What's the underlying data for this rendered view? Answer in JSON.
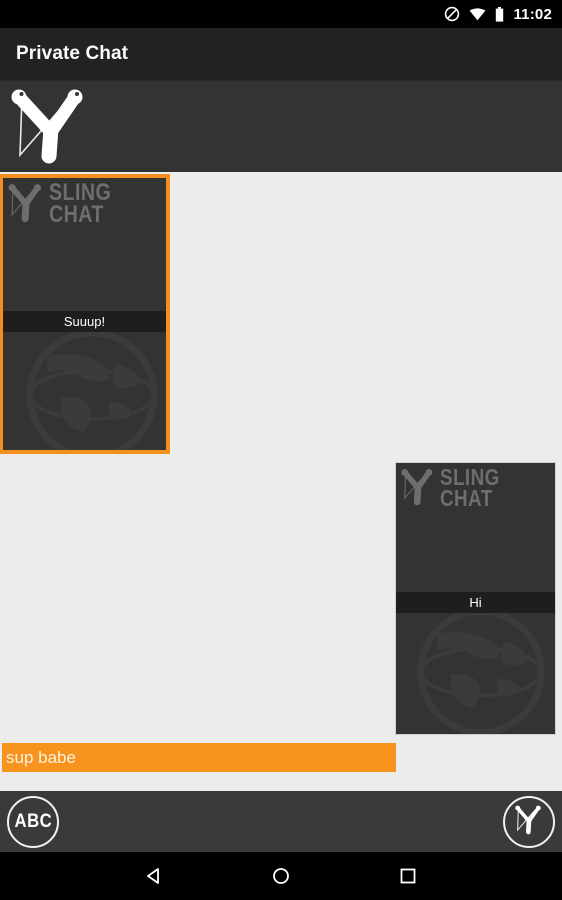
{
  "status_bar": {
    "time": "11:02",
    "icons": [
      "do-not-disturb-icon",
      "wifi-icon",
      "battery-icon"
    ]
  },
  "action_bar": {
    "title": "Private Chat"
  },
  "logo_bar": {
    "logo": "slingshot-logo-icon"
  },
  "messages": [
    {
      "id": "incoming-message",
      "side": "incoming",
      "brand_line1": "SLING",
      "brand_line2": "CHAT",
      "caption": "Suuup!",
      "selected": true,
      "border_color": "#f3901d"
    },
    {
      "id": "outgoing-message",
      "side": "outgoing",
      "brand_line1": "SLING",
      "brand_line2": "CHAT",
      "caption": "Hi",
      "selected": false,
      "border_color": "#cfcfcf"
    }
  ],
  "composer": {
    "value": "sup babe",
    "placeholder": "Type a message",
    "background": "#f7941e"
  },
  "bottom_bar": {
    "abc_label": "ABC",
    "send_icon": "slingshot-send-icon"
  },
  "nav_bar": {
    "back_label": "Back",
    "home_label": "Home",
    "recents_label": "Recent apps"
  },
  "colors": {
    "accent_orange": "#f7941e",
    "selection_orange": "#f3901d",
    "action_bar": "#222222",
    "logo_bar": "#333333",
    "card_bg": "#333333",
    "caption_bg": "#1e1e1e",
    "content_bg": "#ececec",
    "bottom_bar": "#3a3a3a"
  }
}
